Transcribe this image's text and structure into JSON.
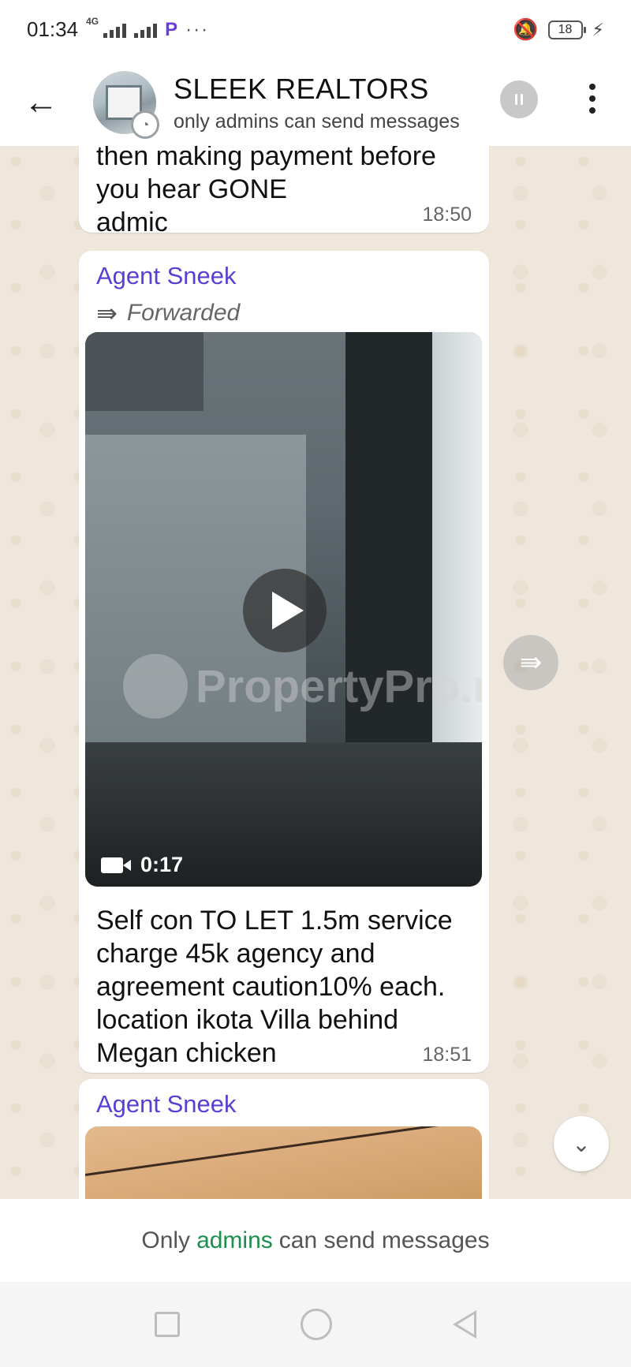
{
  "status_bar": {
    "time": "01:34",
    "network": "4G",
    "app_icon": "P",
    "more": "···",
    "battery": "18",
    "icons": [
      "signal-icon",
      "silent-bell-icon",
      "battery-icon",
      "charging-bolt-icon"
    ]
  },
  "header": {
    "title": "SLEEK REALTORS",
    "subtitle": "only admins can send messages",
    "icons": [
      "back-arrow-icon",
      "group-avatar",
      "voice-chat-icon",
      "more-vert-icon"
    ]
  },
  "messages": [
    {
      "type": "text",
      "text_lines": [
        "then making payment before",
        "you hear GONE",
        "admic"
      ],
      "time": "18:50"
    },
    {
      "type": "video",
      "sender": "Agent Sneek",
      "forwarded_label": "Forwarded",
      "duration": "0:17",
      "watermark": "PropertyPro.ng",
      "caption_lines": [
        "Self con TO LET 1.5m service",
        "charge 45k agency and",
        "agreement caution10% each.",
        "location ikota Villa behind",
        "Megan chicken"
      ],
      "time": "18:51"
    },
    {
      "type": "image",
      "sender": "Agent Sneek"
    }
  ],
  "notice": {
    "prefix": "Only",
    "link": "admins",
    "suffix": "can send messages"
  },
  "colors": {
    "sender": "#5b3fd4",
    "link": "#1b8f4d",
    "chat_bg": "#efe7dc"
  }
}
